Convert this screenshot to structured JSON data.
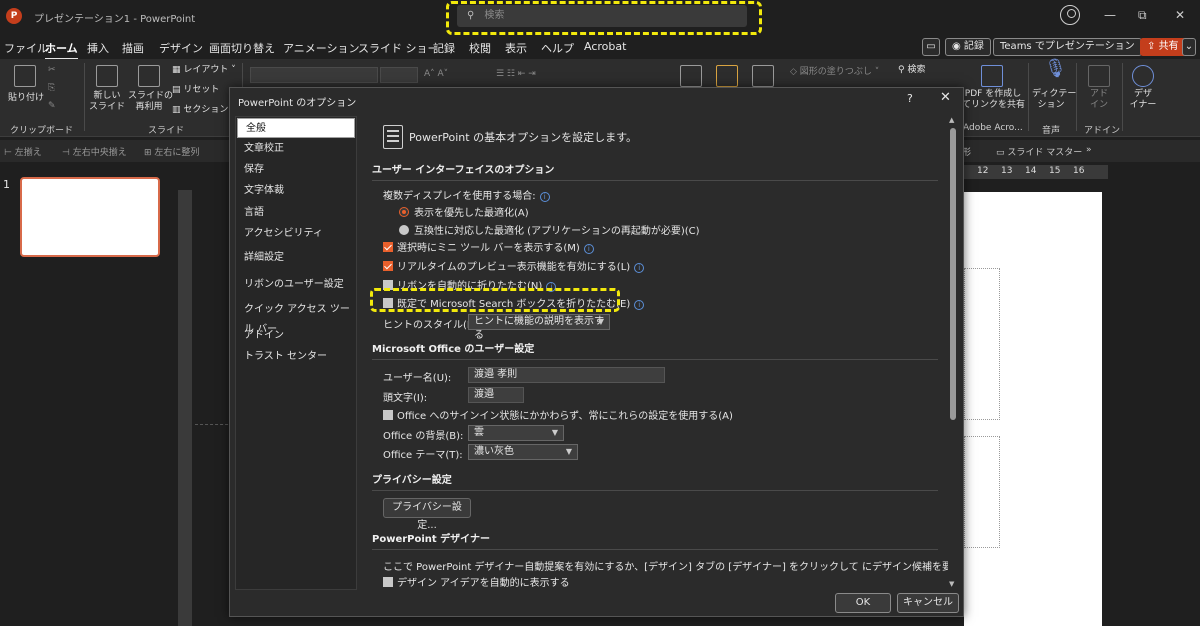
{
  "window": {
    "title": "プレゼンテーション1 - PowerPoint",
    "search_placeholder": "検索",
    "min": "—",
    "restore": "⧉",
    "close": "✕"
  },
  "menu": {
    "tabs": [
      "ファイル",
      "ホーム",
      "挿入",
      "描画",
      "デザイン",
      "画面切り替え",
      "アニメーション",
      "スライド ショー",
      "記録",
      "校閲",
      "表示",
      "ヘルプ",
      "Acrobat"
    ],
    "active_tab": "ホーム",
    "record_btn": "◉ 記録",
    "teams_btn": "Teams でプレゼンテーション",
    "share_btn": "共有"
  },
  "ribbon": {
    "paste": "貼り付け",
    "clipboard": "クリップボード",
    "new_slide": "新しい\nスライド",
    "reuse_slide": "スライドの\n再利用",
    "layout": "レイアウト",
    "reset": "リセット",
    "section": "セクション",
    "slides": "スライド",
    "shape_fill": "図形の塗りつぶし",
    "search": "検索",
    "pdf_share": "PDF を作成し\nてリンクを共有",
    "adobe": "Adobe Acro...",
    "dictation": "ディクテー\nション",
    "voice": "音声",
    "addin": "アド\nイン",
    "addin_group": "アドイン",
    "designer": "デザ\nイナー"
  },
  "subbar": {
    "items": [
      "左揃え",
      "左右中央揃え",
      "左右に整列"
    ],
    "slide_master": "スライド マスター",
    "more": "»",
    "shape": "形"
  },
  "ruler": {
    "h_ticks": [
      "12",
      "13",
      "14",
      "15",
      "16"
    ]
  },
  "slide_pane": {
    "slide_number": "1"
  },
  "dialog": {
    "title": "PowerPoint のオプション",
    "help": "?",
    "close": "✕",
    "nav": [
      "全般",
      "文章校正",
      "保存",
      "文字体裁",
      "言語",
      "アクセシビリティ",
      "詳細設定",
      "リボンのユーザー設定",
      "クイック アクセス ツール バー",
      "アドイン",
      "トラスト センター"
    ],
    "active_nav": "全般",
    "header": "PowerPoint の基本オプションを設定します。",
    "sections": {
      "ui": "ユーザー インターフェイスのオプション",
      "office_user": "Microsoft Office のユーザー設定",
      "privacy": "プライバシー設定",
      "designer": "PowerPoint デザイナー"
    },
    "ui_options": {
      "multi_display": "複数ディスプレイを使用する場合:",
      "radio_appearance": "表示を優先した最適化(A)",
      "radio_compat": "互換性に対応した最適化 (アプリケーションの再起動が必要)(C)",
      "mini_toolbar": "選択時にミニ ツール バーを表示する(M)",
      "live_preview": "リアルタイムのプレビュー表示機能を有効にする(L)",
      "ribbon_collapse": "リボンを自動的に折りたたむ(N)",
      "search_collapse": "既定で Microsoft Search ボックスを折りたたむ(E)",
      "tooltip_style_label": "ヒントのスタイル(R):",
      "tooltip_style_value": "ヒントに機能の説明を表示する"
    },
    "user_options": {
      "username_label": "ユーザー名(U):",
      "username_value": "渡邉 孝則",
      "initials_label": "頭文字(I):",
      "initials_value": "渡邉",
      "always_use": "Office へのサインイン状態にかかわらず、常にこれらの設定を使用する(A)",
      "background_label": "Office の背景(B):",
      "background_value": "雲",
      "theme_label": "Office テーマ(T):",
      "theme_value": "濃い灰色"
    },
    "privacy_btn": "プライバシー設定...",
    "designer_text": "ここで PowerPoint デザイナー自動提案を有効にするか、[デザイン] タブの [デザイナー] をクリックして にデザイン候補を要求します。",
    "designer_auto": "デザイン アイデアを自動的に表示する",
    "ok": "OK",
    "cancel": "キャンセル"
  }
}
